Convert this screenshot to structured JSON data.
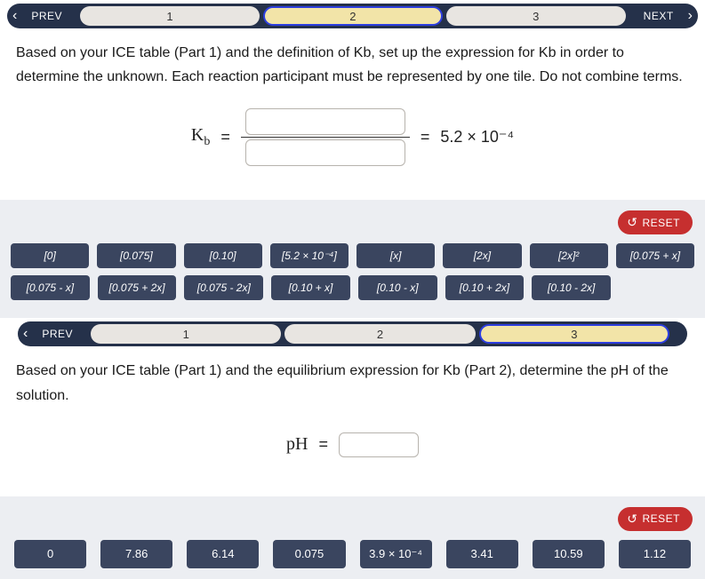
{
  "nav1": {
    "prev": "PREV",
    "next": "NEXT",
    "steps": [
      "1",
      "2",
      "3"
    ],
    "active": 1
  },
  "instruction1": "Based on your ICE table (Part 1) and the definition of Kb, set up the expression for Kb in order to determine the unknown. Each reaction participant must be represented by one tile. Do not combine terms.",
  "kb": {
    "label_main": "K",
    "label_sub": "b",
    "eq1": "=",
    "eq2": "=",
    "value": "5.2 × 10⁻⁴"
  },
  "reset_label": "RESET",
  "tiles_row1": [
    "[0]",
    "[0.075]",
    "[0.10]",
    "[5.2 × 10⁻⁴]",
    "[x]",
    "[2x]",
    "[2x]²",
    "[0.075 + x]"
  ],
  "tiles_row2": [
    "[0.075 - x]",
    "[0.075 + 2x]",
    "[0.075 - 2x]",
    "[0.10 + x]",
    "[0.10 - x]",
    "[0.10 + 2x]",
    "[0.10 - 2x]"
  ],
  "nav2": {
    "prev": "PREV",
    "steps": [
      "1",
      "2",
      "3"
    ],
    "active": 2
  },
  "instruction2": "Based on your ICE table (Part 1) and the equilibrium expression for Kb (Part 2), determine the pH of the solution.",
  "ph": {
    "label": "pH",
    "eq": "="
  },
  "tiles_row3": [
    "0",
    "7.86",
    "6.14",
    "0.075",
    "3.9 × 10⁻⁴",
    "3.41",
    "10.59",
    "1.12"
  ]
}
